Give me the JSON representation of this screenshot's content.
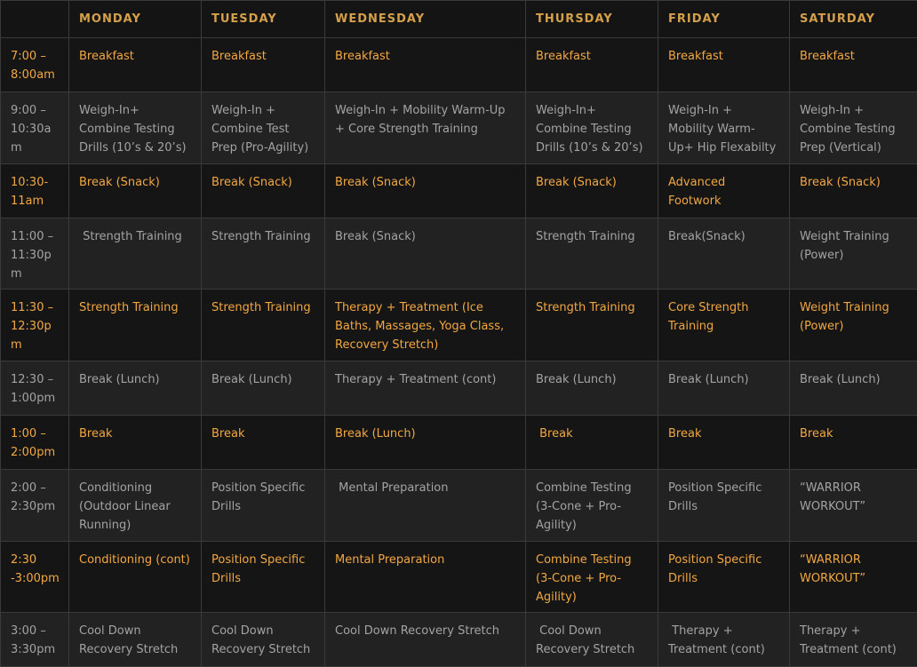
{
  "days": [
    "MONDAY",
    "TUESDAY",
    "WEDNESDAY",
    "THURSDAY",
    "FRIDAY",
    "SATURDAY"
  ],
  "rows": [
    {
      "time": "7:00 – 8:00am",
      "cells": [
        "Breakfast",
        "Breakfast",
        "Breakfast",
        "Breakfast",
        "Breakfast",
        "Breakfast"
      ]
    },
    {
      "time": "9:00 – 10:30am",
      "cells": [
        "Weigh-In+ Combine Testing Drills (10’s & 20’s)",
        "Weigh-In + Combine Test Prep (Pro-Agility)",
        "Weigh-In + Mobility Warm-Up + Core Strength Training",
        "Weigh-In+ Combine Testing Drills (10’s & 20’s)",
        "Weigh-In + Mobility Warm-Up+ Hip Flexabilty",
        "Weigh-In + Combine Testing Prep (Vertical)"
      ]
    },
    {
      "time": "10:30-11am",
      "cells": [
        "Break (Snack)",
        "Break (Snack)",
        "Break (Snack)",
        "Break (Snack)",
        "Advanced Footwork",
        "Break (Snack)"
      ]
    },
    {
      "time": "11:00 – 11:30pm",
      "cells": [
        " Strength Training",
        "Strength Training",
        "Break (Snack)",
        "Strength Training",
        "Break(Snack)",
        "Weight Training (Power)"
      ]
    },
    {
      "time": "11:30 – 12:30pm",
      "cells": [
        "Strength Training",
        "Strength Training",
        "Therapy + Treatment (Ice Baths, Massages, Yoga Class, Recovery Stretch)",
        "Strength Training",
        "Core Strength Training",
        "Weight Training (Power)"
      ]
    },
    {
      "time": "12:30 – 1:00pm",
      "cells": [
        "Break (Lunch)",
        "Break (Lunch)",
        "Therapy + Treatment (cont)",
        "Break (Lunch)",
        "Break (Lunch)",
        "Break (Lunch)"
      ]
    },
    {
      "time": "1:00 – 2:00pm",
      "cells": [
        "Break",
        "Break",
        "Break (Lunch)",
        " Break",
        "Break",
        "Break"
      ]
    },
    {
      "time": "2:00 – 2:30pm",
      "cells": [
        "Conditioning (Outdoor Linear Running)",
        "Position Specific Drills",
        " Mental Preparation",
        "Combine Testing (3-Cone + Pro-Agility)",
        "Position Specific Drills",
        "“WARRIOR WORKOUT”"
      ]
    },
    {
      "time": "2:30 -3:00pm",
      "cells": [
        "Conditioning (cont)",
        "Position Specific Drills",
        "Mental Preparation",
        "Combine Testing (3-Cone + Pro-Agility)",
        "Position Specific Drills",
        "“WARRIOR WORKOUT”"
      ]
    },
    {
      "time": "3:00 – 3:30pm",
      "cells": [
        "Cool Down Recovery Stretch",
        "Cool Down Recovery Stretch",
        "Cool Down Recovery Stretch",
        " Cool Down Recovery Stretch",
        " Therapy + Treatment (cont)",
        "Therapy + Treatment (cont)"
      ]
    }
  ]
}
